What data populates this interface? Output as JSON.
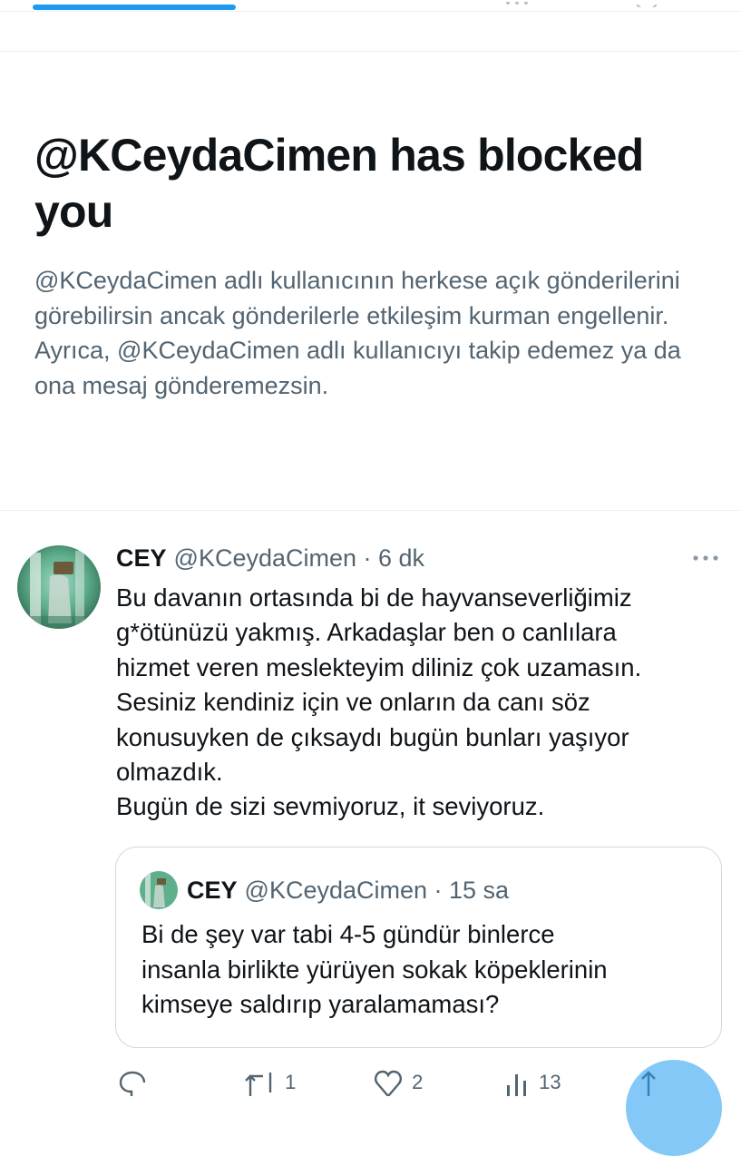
{
  "block_notice": {
    "title": "@KCeydaCimen has blocked you",
    "description": "@KCeydaCimen adlı kullanıcının herkese açık gönderilerini görebilirsin ancak gönderilerle etkileşim kurman engellenir. Ayrıca, @KCeydaCimen adlı kullanıcıyı takip edemez ya da ona mesaj gönderemezsin."
  },
  "tweet": {
    "author_name": "CEY",
    "handle_time": "@KCeydaCimen · 6 dk",
    "avatar_icon": "profile-photo",
    "more_icon": "more-icon",
    "text_lines": [
      "Bu davanın ortasında bi de hayvanseverliğimiz",
      "g*ötünüzü yakmış. Arkadaşlar ben o canlılara",
      "hizmet veren meslekteyim diliniz çok uzamasın.",
      "Sesiniz kendiniz için ve onların da canı söz",
      "konusuyken de çıksaydı bugün bunları yaşıyor",
      "olmazdık.",
      "Bugün de sizi sevmiyoruz, it seviyoruz."
    ]
  },
  "quote": {
    "author_name": "CEY",
    "handle_time": "@KCeydaCimen · 15 sa",
    "text_lines": [
      "Bi de şey var tabi 4-5 gündür binlerce",
      "insanla birlikte yürüyen sokak köpeklerinin",
      "kimseye saldırıp yaralamaması?"
    ]
  },
  "actions": {
    "reply_icon": "reply-icon",
    "retweet_icon": "retweet-icon",
    "retweet_count": "1",
    "like_icon": "heart-icon",
    "like_count": "2",
    "views_icon": "views-icon",
    "views_count": "13",
    "compose_icon": "compose-fab"
  },
  "colors": {
    "accent": "#1d9bf0",
    "text_primary": "#0f1419",
    "text_secondary": "#536471",
    "border": "#cfd9de"
  }
}
